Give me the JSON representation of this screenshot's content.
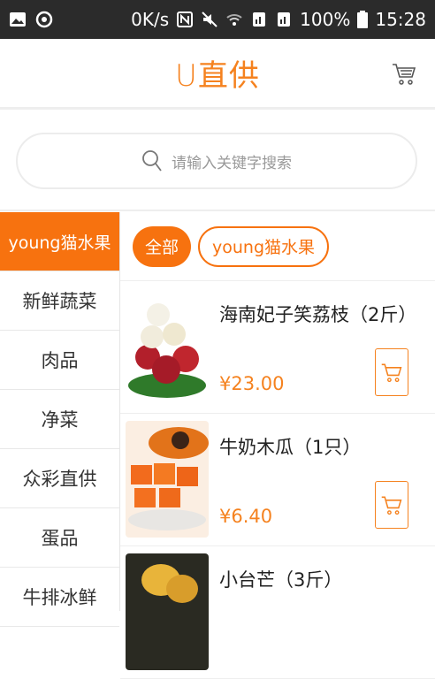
{
  "statusbar": {
    "speed": "0K/s",
    "battery": "100%",
    "time": "15:28"
  },
  "header": {
    "title": "U直供"
  },
  "search": {
    "placeholder": "请输入关键字搜索"
  },
  "sidebar": {
    "items": [
      "young猫水果",
      "新鲜蔬菜",
      "肉品",
      "净菜",
      "众彩直供",
      "蛋品",
      "牛排冰鲜"
    ]
  },
  "filters": {
    "all_label": "全部",
    "category_label": "young猫水果"
  },
  "products": [
    {
      "name": "海南妃子笑荔枝（2斤）",
      "price": "¥23.00"
    },
    {
      "name": "牛奶木瓜（1只）",
      "price": "¥6.40"
    },
    {
      "name": "小台芒（3斤）",
      "price": ""
    }
  ],
  "colors": {
    "accent": "#f7720f"
  }
}
